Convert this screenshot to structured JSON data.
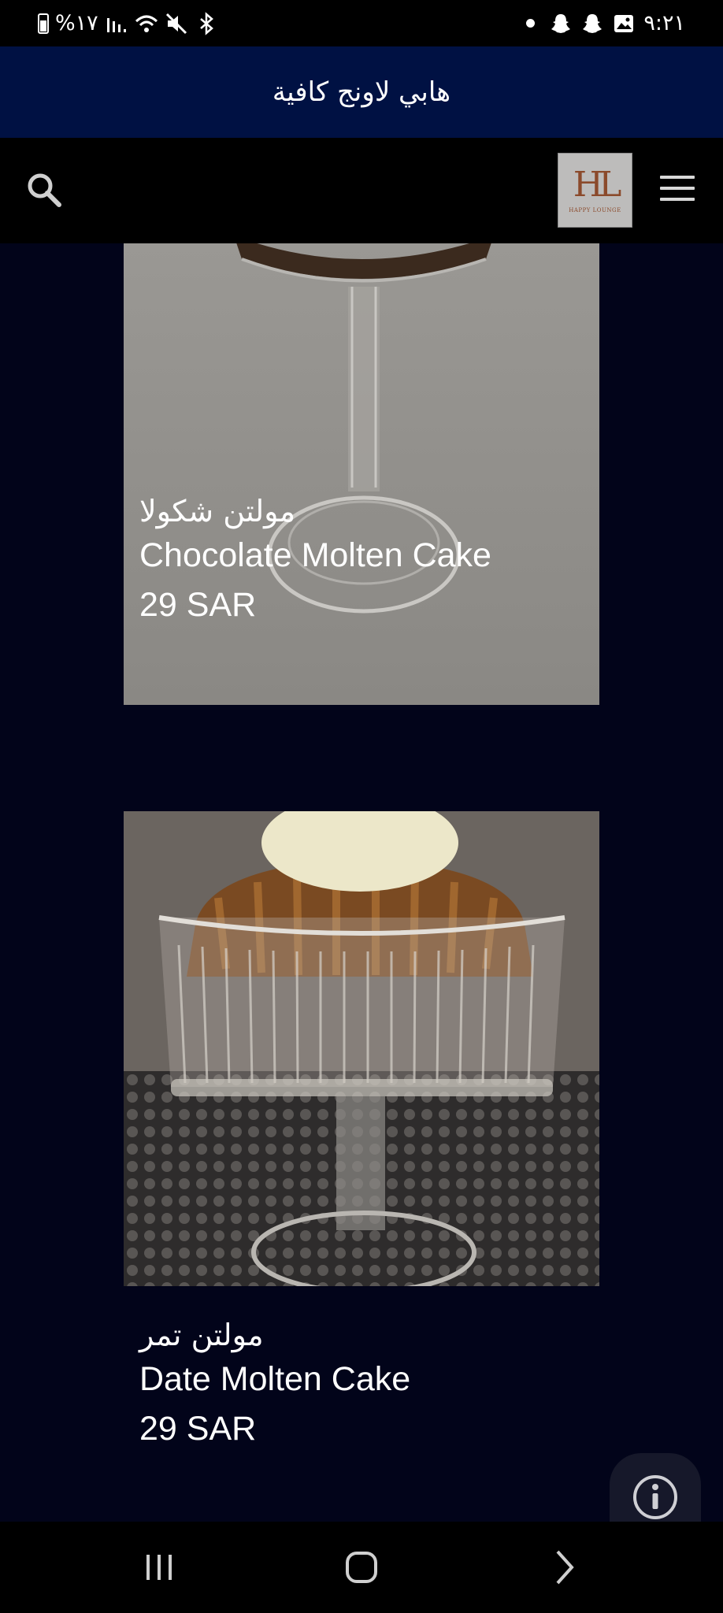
{
  "status_bar": {
    "battery_percent": "%١٧",
    "time": "٩:٢١",
    "icons": [
      "battery-icon",
      "signal-icon",
      "wifi-icon",
      "mute-icon",
      "bluetooth-icon",
      "notification-dot-icon",
      "snapchat-icon",
      "snapchat-icon",
      "gallery-icon"
    ]
  },
  "title_bar": {
    "title": "هابي لاونج كافية"
  },
  "header": {
    "search_icon": "search-icon",
    "logo_mark": "HL",
    "logo_text": "HAPPY LOUNGE",
    "menu_icon": "hamburger-menu-icon"
  },
  "products": [
    {
      "name_ar": "مولتن شكولا",
      "name_en": "Chocolate Molten Cake",
      "price": "29 SAR"
    },
    {
      "name_ar": "مولتن تمر",
      "name_en": "Date Molten Cake",
      "price": "29 SAR"
    }
  ],
  "info_button": {
    "icon": "info-icon"
  },
  "nav_bar": {
    "icons": [
      "recent-apps-icon",
      "home-icon",
      "back-icon"
    ]
  },
  "colors": {
    "title_bar_bg": "#001143",
    "page_bg": "#02041a",
    "header_bg": "#000000",
    "logo_brown": "#8b4a2b"
  }
}
